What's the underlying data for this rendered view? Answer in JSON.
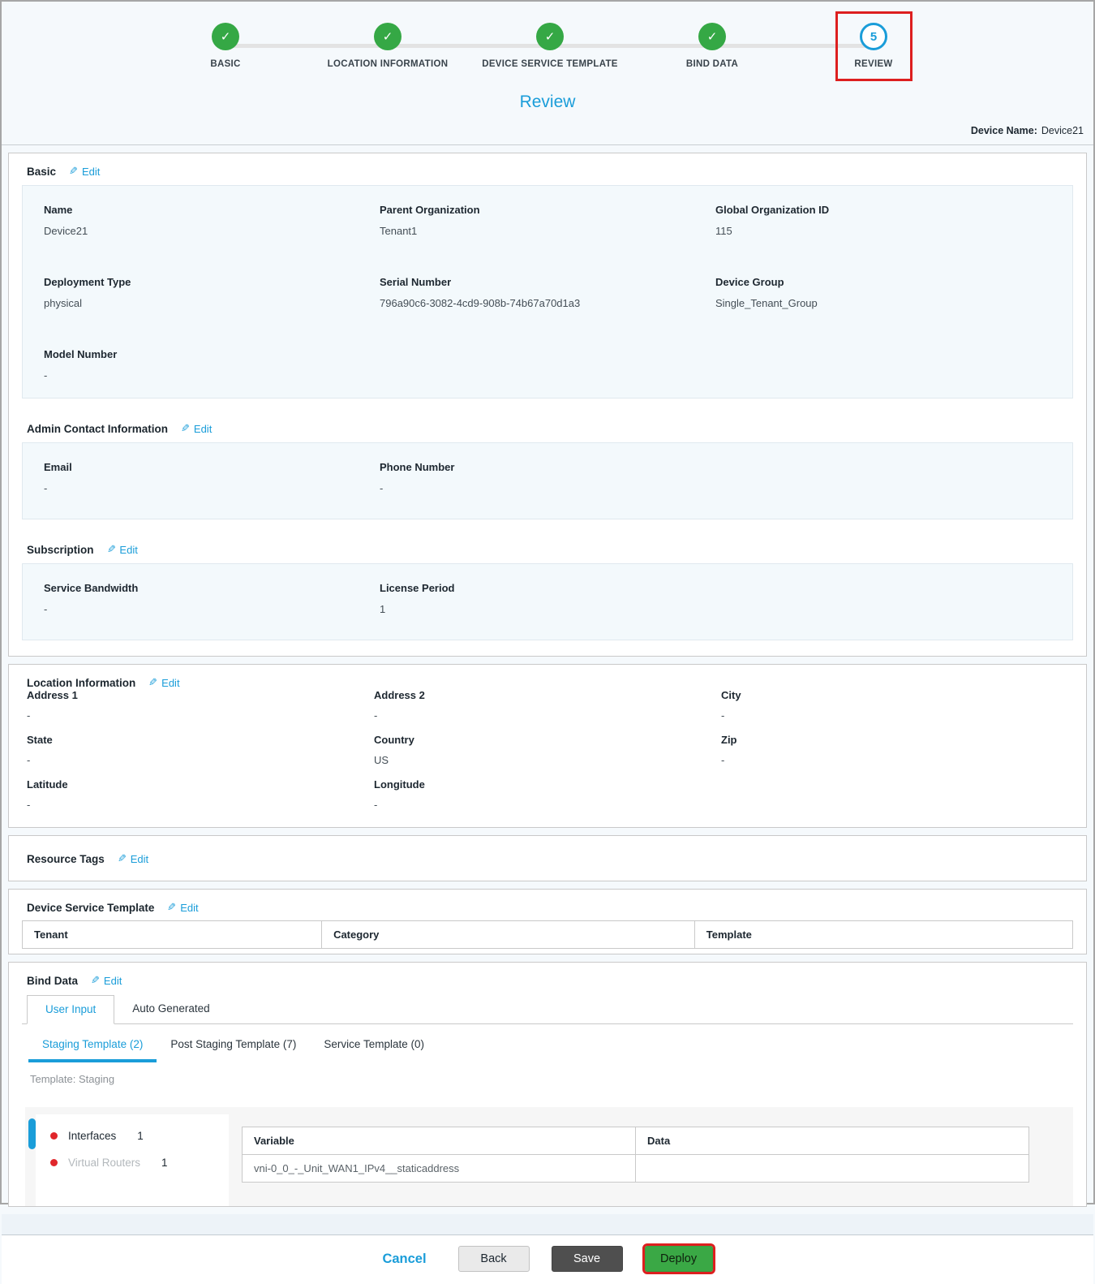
{
  "colors": {
    "accent_blue": "#1a9dd9",
    "success_green": "#35a845",
    "annotation_red": "#dd1f1f",
    "deploy_green": "#3aa845"
  },
  "stepper": {
    "check_glyph": "✓",
    "steps": [
      {
        "label": "BASIC",
        "state": "done"
      },
      {
        "label": "LOCATION INFORMATION",
        "state": "done"
      },
      {
        "label": "DEVICE SERVICE TEMPLATE",
        "state": "done"
      },
      {
        "label": "BIND DATA",
        "state": "done"
      },
      {
        "label": "REVIEW",
        "state": "current",
        "number": "5"
      }
    ]
  },
  "header": {
    "page_title": "Review",
    "device_name_label": "Device Name:",
    "device_name_value": "Device21"
  },
  "common": {
    "edit_label": "Edit",
    "edit_glyph": "✎"
  },
  "sections": {
    "basic": {
      "title": "Basic",
      "fields": [
        {
          "label": "Name",
          "value": "Device21"
        },
        {
          "label": "Parent Organization",
          "value": "Tenant1"
        },
        {
          "label": "Global Organization ID",
          "value": "115"
        },
        {
          "label": "Deployment Type",
          "value": "physical"
        },
        {
          "label": "Serial Number",
          "value": "796a90c6-3082-4cd9-908b-74b67a70d1a3"
        },
        {
          "label": "Device Group",
          "value": "Single_Tenant_Group"
        },
        {
          "label": "Model Number",
          "value": "-"
        }
      ]
    },
    "admin_contact": {
      "title": "Admin Contact Information",
      "fields": [
        {
          "label": "Email",
          "value": "-"
        },
        {
          "label": "Phone Number",
          "value": "-"
        }
      ]
    },
    "subscription": {
      "title": "Subscription",
      "fields": [
        {
          "label": "Service Bandwidth",
          "value": "-"
        },
        {
          "label": "License Period",
          "value": "1"
        }
      ]
    },
    "location": {
      "title": "Location Information",
      "fields": [
        {
          "label": "Address 1",
          "value": "-"
        },
        {
          "label": "Address 2",
          "value": "-"
        },
        {
          "label": "City",
          "value": "-"
        },
        {
          "label": "State",
          "value": "-"
        },
        {
          "label": "Country",
          "value": "US"
        },
        {
          "label": "Zip",
          "value": "-"
        },
        {
          "label": "Latitude",
          "value": "-"
        },
        {
          "label": "Longitude",
          "value": "-"
        }
      ]
    },
    "resource_tags": {
      "title": "Resource Tags"
    },
    "device_service_template": {
      "title": "Device Service Template",
      "columns": [
        "Tenant",
        "Category",
        "Template"
      ]
    },
    "bind_data": {
      "title": "Bind Data",
      "tabs": [
        "User Input",
        "Auto Generated"
      ],
      "subtabs": [
        "Staging Template (2)",
        "Post Staging Template (7)",
        "Service Template (0)"
      ],
      "template_label": "Template: Staging",
      "list": [
        {
          "label": "Interfaces",
          "count": "1"
        },
        {
          "label": "Virtual Routers",
          "count": "1"
        }
      ],
      "table": {
        "columns": [
          "Variable",
          "Data"
        ],
        "rows": [
          {
            "variable": "vni-0_0_-_Unit_WAN1_IPv4__staticaddress",
            "data": ""
          }
        ]
      }
    }
  },
  "footer": {
    "cancel": "Cancel",
    "back": "Back",
    "save": "Save",
    "deploy": "Deploy"
  }
}
